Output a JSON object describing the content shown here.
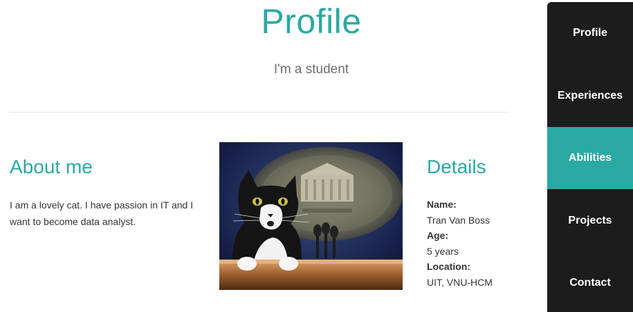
{
  "header": {
    "title": "Profile",
    "subtitle": "I'm a student"
  },
  "about": {
    "heading": "About me",
    "text": "I am a lovely cat. I have passion in IT and I want to become data analyst."
  },
  "details": {
    "heading": "Details",
    "items": [
      {
        "label": "Name:",
        "value": "Tran Van Boss"
      },
      {
        "label": "Age:",
        "value": "5 years"
      },
      {
        "label": "Location:",
        "value": "UIT, VNU-HCM"
      }
    ]
  },
  "nav": {
    "items": [
      {
        "label": "Profile"
      },
      {
        "label": "Experiences"
      },
      {
        "label": "Abilities",
        "active": true
      },
      {
        "label": "Projects"
      },
      {
        "label": "Contact"
      }
    ]
  },
  "colors": {
    "accent": "#2aa9a3",
    "sidebar_bg": "#1c1c1c"
  },
  "icons": {
    "photo": "cat-photo"
  }
}
